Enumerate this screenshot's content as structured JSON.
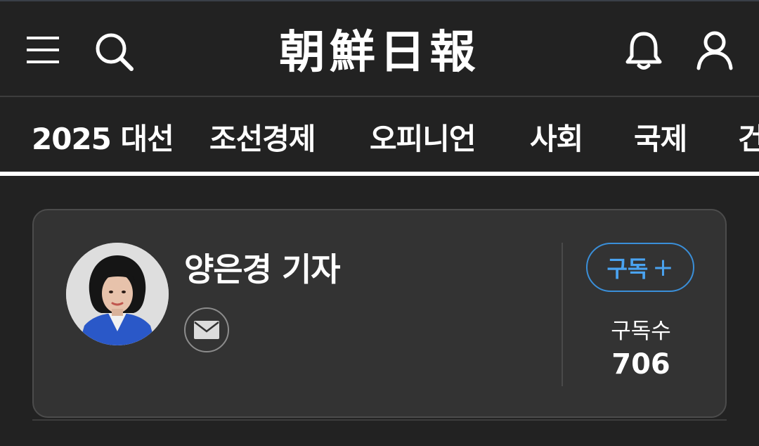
{
  "header": {
    "logo_text": "朝鮮日報",
    "icons": [
      "menu-icon",
      "search-icon",
      "bell-icon",
      "user-icon"
    ]
  },
  "nav": {
    "items": [
      "2025 대선",
      "조선경제",
      "오피니언",
      "사회",
      "국제",
      "건"
    ]
  },
  "profile": {
    "name": "양은경 기자",
    "subscribe_label": "구독",
    "subscribe_plus": "+",
    "subscribers_label": "구독수",
    "subscribers_count": "706",
    "mail_icon": "mail-icon"
  },
  "colors": {
    "background": "#222222",
    "card": "#333333",
    "accent": "#4aa3f0"
  }
}
